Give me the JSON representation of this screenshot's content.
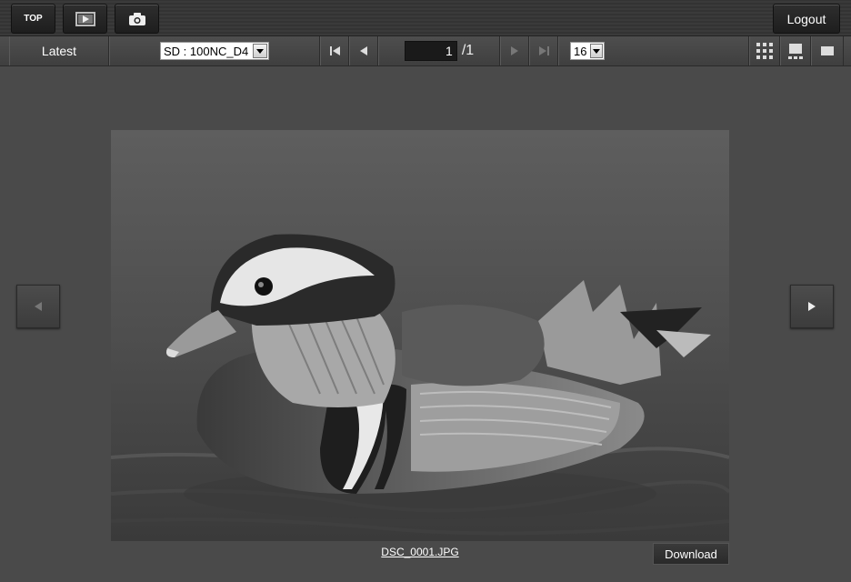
{
  "header": {
    "top_label": "TOP",
    "playback_icon": "playback-icon",
    "camera_icon": "camera-icon",
    "logout_label": "Logout"
  },
  "toolbar": {
    "latest_label": "Latest",
    "folder_select_value": "SD : 100NC_D4",
    "current_page": "1",
    "total_pages": "/1",
    "per_page_value": "16",
    "view_icons": [
      "grid-view-icon",
      "filmstrip-view-icon",
      "single-view-icon"
    ]
  },
  "viewer": {
    "filename": "DSC_0001.JPG",
    "download_label": "Download",
    "colors": {
      "background": "#4a4a4a",
      "toolbar": "#444444",
      "header": "#363636"
    }
  }
}
